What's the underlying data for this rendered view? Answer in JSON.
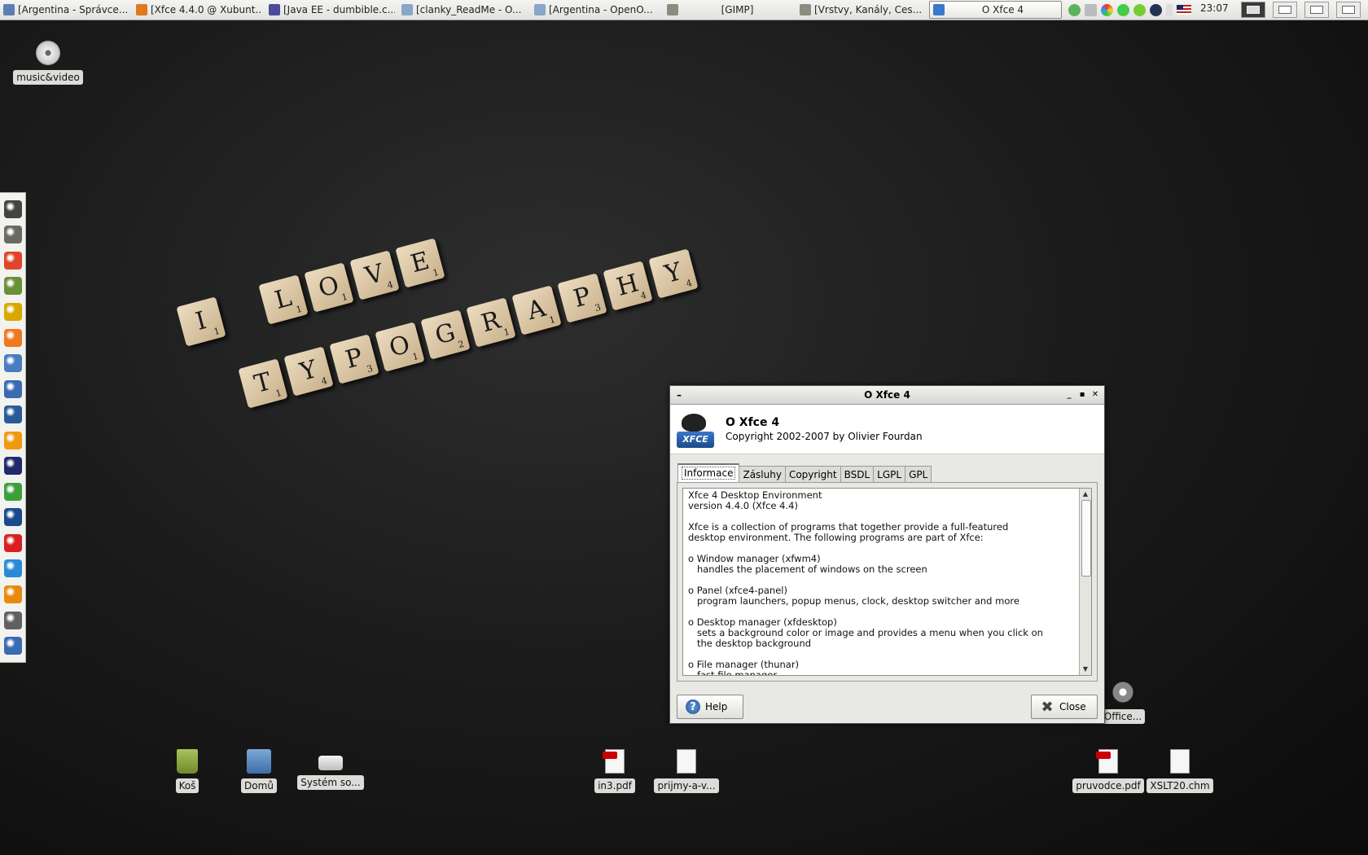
{
  "taskbar": {
    "tasks": [
      {
        "label": "[Argentina - Správce...",
        "icon": "folder-icon",
        "color": "#5b7fb3"
      },
      {
        "label": "[Xfce 4.4.0 @ Xubunt...",
        "icon": "firefox-icon",
        "color": "#e07a1f"
      },
      {
        "label": "[Java EE - dumbible.c...",
        "icon": "eclipse-icon",
        "color": "#4b4b9b"
      },
      {
        "label": "[clanky_ReadMe - O...",
        "icon": "document-icon",
        "color": "#8aa6c8"
      },
      {
        "label": "[Argentina - OpenO...",
        "icon": "document-icon",
        "color": "#8aa6c8"
      },
      {
        "label": "[GIMP]",
        "icon": "gimp-icon",
        "color": "#8c8c80"
      },
      {
        "label": "[Vrstvy, Kanály, Ces...",
        "icon": "gimp-icon",
        "color": "#8c8c80"
      },
      {
        "label": "O Xfce 4",
        "icon": "xfce-icon",
        "color": "#3a78c8"
      }
    ],
    "clock": "23:07"
  },
  "desktop_icons": [
    {
      "name": "music-video-icon",
      "label": "music&video",
      "glyph": "g-cd"
    },
    {
      "name": "trash-icon",
      "label": "Koš",
      "glyph": "g-trash"
    },
    {
      "name": "home-icon",
      "label": "Domů",
      "glyph": "g-home"
    },
    {
      "name": "filesystem-icon",
      "label": "Systém so...",
      "glyph": "g-drive"
    },
    {
      "name": "pdf-file-icon",
      "label": "in3.pdf",
      "glyph": "g-pdf"
    },
    {
      "name": "document-file-icon",
      "label": "prijmy-a-v...",
      "glyph": "g-doc"
    },
    {
      "name": "pdf-file-icon",
      "label": "pruvodce.pdf",
      "glyph": "g-pdf"
    },
    {
      "name": "chm-file-icon",
      "label": "XSLT20.chm",
      "glyph": "g-doc"
    },
    {
      "name": "office-icon",
      "label": "Office...",
      "glyph": "g-office"
    }
  ],
  "dock_colors": [
    "#444444",
    "#6a6a60",
    "#e0442a",
    "#6a8f3a",
    "#d8a800",
    "#f07820",
    "#4a7cc0",
    "#3a6ab0",
    "#2a5a9a",
    "#f09a10",
    "#202a6a",
    "#3aa03a",
    "#1a4a8a",
    "#d82020",
    "#2a8ad8",
    "#e88a10",
    "#606060",
    "#3a6ab0"
  ],
  "wallpaper": {
    "row1": [
      {
        "letter": "I",
        "score": "1"
      },
      {
        "letter": "L",
        "score": "1"
      },
      {
        "letter": "O",
        "score": "1"
      },
      {
        "letter": "V",
        "score": "4"
      },
      {
        "letter": "E",
        "score": "1"
      }
    ],
    "row2": [
      {
        "letter": "T",
        "score": "1"
      },
      {
        "letter": "Y",
        "score": "4"
      },
      {
        "letter": "P",
        "score": "3"
      },
      {
        "letter": "O",
        "score": "1"
      },
      {
        "letter": "G",
        "score": "2"
      },
      {
        "letter": "R",
        "score": "1"
      },
      {
        "letter": "A",
        "score": "1"
      },
      {
        "letter": "P",
        "score": "3"
      },
      {
        "letter": "H",
        "score": "4"
      },
      {
        "letter": "Y",
        "score": "4"
      }
    ]
  },
  "dialog": {
    "title": "O Xfce 4",
    "heading": "O Xfce 4",
    "copyright": "Copyright 2002-2007 by Olivier Fourdan",
    "logo_text": "XFCE",
    "tabs": [
      "Informace",
      "Zásluhy",
      "Copyright",
      "BSDL",
      "LGPL",
      "GPL"
    ],
    "content": "Xfce 4 Desktop Environment\nversion 4.4.0 (Xfce 4.4)\n\nXfce is a collection of programs that together provide a full-featured\ndesktop environment. The following programs are part of Xfce:\n\no Window manager (xfwm4)\n   handles the placement of windows on the screen\n\no Panel (xfce4-panel)\n   program launchers, popup menus, clock, desktop switcher and more\n\no Desktop manager (xfdesktop)\n   sets a background color or image and provides a menu when you click on\n   the desktop background\n\no File manager (thunar)\n   fast file manager",
    "help_label": "Help",
    "close_label": "Close"
  }
}
